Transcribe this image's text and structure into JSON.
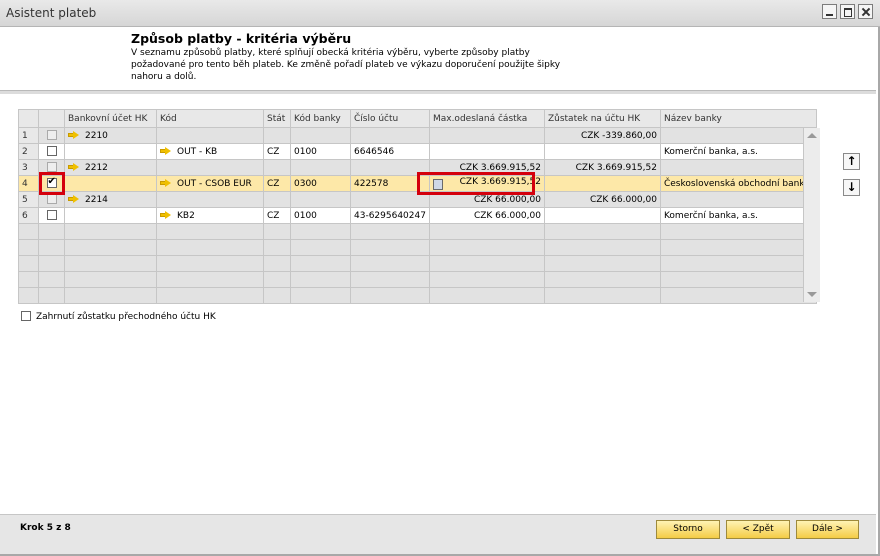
{
  "window": {
    "title": "Asistent plateb"
  },
  "header": {
    "title": "Způsob platby - kritéria výběru",
    "description_lines": [
      "V seznamu způsobů platby, které splňují obecká kritéria výběru, vyberte způsoby platby",
      "požadované pro tento běh plateb. Ke změně pořadí plateb ve výkazu doporučení použijte šipky",
      "nahoru a dolů."
    ]
  },
  "table": {
    "columns": [
      "",
      "",
      "Bankovní účet HK",
      "Kód",
      "Stát",
      "Kód banky",
      "Číslo účtu",
      "Max.odeslaná částka",
      "Zůstatek na účtu HK",
      "Název banky"
    ],
    "rows": [
      {
        "n": "1",
        "checkbox": "disabled",
        "account": "2210",
        "code": "",
        "state": "",
        "bank_code": "",
        "acct_no": "",
        "max_amount": "",
        "balance": "CZK -339.860,00",
        "bank": ""
      },
      {
        "n": "2",
        "checkbox": "off",
        "account": "",
        "code": "OUT - KB",
        "state": "CZ",
        "bank_code": "0100",
        "acct_no": "6646546",
        "max_amount": "",
        "balance": "",
        "bank": "Komerční banka, a.s."
      },
      {
        "n": "3",
        "checkbox": "disabled",
        "account": "2212",
        "code": "",
        "state": "",
        "bank_code": "",
        "acct_no": "",
        "max_amount": "CZK 3.669.915,52",
        "balance": "CZK 3.669.915,52",
        "bank": ""
      },
      {
        "n": "4",
        "checkbox": "on",
        "account": "",
        "code": "OUT - CSOB EUR",
        "state": "CZ",
        "bank_code": "0300",
        "acct_no": "422578",
        "max_amount": "CZK 3.669.915,52",
        "balance": "",
        "bank": "Československá obchodní banka,"
      },
      {
        "n": "5",
        "checkbox": "disabled",
        "account": "2214",
        "code": "",
        "state": "",
        "bank_code": "",
        "acct_no": "",
        "max_amount": "CZK 66.000,00",
        "balance": "CZK 66.000,00",
        "bank": ""
      },
      {
        "n": "6",
        "checkbox": "off",
        "account": "",
        "code": "KB2",
        "state": "CZ",
        "bank_code": "0100",
        "acct_no": "43-6295640247",
        "max_amount": "CZK 66.000,00",
        "balance": "",
        "bank": "Komerční banka, a.s."
      }
    ]
  },
  "options": {
    "include_transit_label": "Zahrnutí zůstatku přechodného účtu HK"
  },
  "footer": {
    "step": "Krok 5 z 8",
    "cancel": "Storno",
    "back": "< Zpět",
    "next": "Dále >"
  },
  "icons": {
    "move_up": "arrow-up-icon",
    "move_down": "arrow-down-icon",
    "link_arrow": "yellow-arrow-icon",
    "calculator": "calculator-icon"
  },
  "colors": {
    "selected_row": "#fde8a8",
    "highlight_box": "#d4000c",
    "button": "#f4cc46"
  }
}
